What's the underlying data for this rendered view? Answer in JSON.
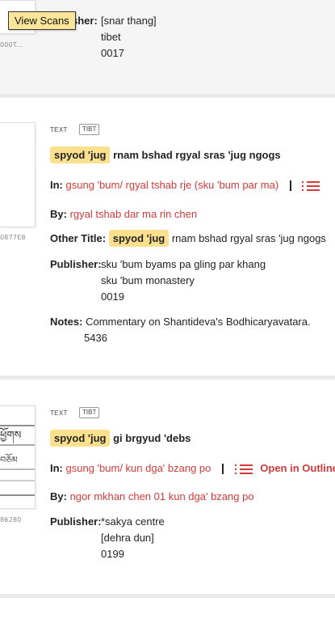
{
  "tooltip": "View Scans",
  "card0": {
    "thumb_id": "000T...",
    "publisher_label_partial": "sher:",
    "publisher_lines": [
      "[snar thang]",
      "tibet",
      "0017"
    ]
  },
  "card1": {
    "type": "TEXT",
    "script": "TIBT",
    "title_highlight": "spyod 'jug",
    "title_rest": "rnam bshad rgyal sras 'jug ngogs",
    "in_label": "In:",
    "in_link": "gsung 'bum/ rgyal tshab rje (sku 'bum par ma)",
    "by_label": "By:",
    "by_link": "rgyal tshab dar ma rin chen",
    "other_title_label": "Other Title:",
    "other_title_highlight": "spyod 'jug",
    "other_title_rest": "rnam bshad rgyal sras 'jug ngogs",
    "publisher_label": "Publisher:",
    "publisher_lines": [
      "sku 'bum byams pa gling par khang",
      "sku 'bum monastery",
      "0019"
    ],
    "notes_label": "Notes:",
    "notes_lines": [
      "Commentary on Shantideva's Bodhicaryavatara.",
      "5436"
    ],
    "thumb_id": "0877E8"
  },
  "card2": {
    "type": "TEXT",
    "script": "TIBT",
    "title_highlight": "spyod 'jug",
    "title_rest": "gi brgyud 'debs",
    "in_label": "In:",
    "in_link": "gsung 'bum/ kun dga' bzang po",
    "outline_label": "Open in Outline",
    "by_label": "By:",
    "by_link": "ngor mkhan chen 01 kun dga' bzang po",
    "publisher_label": "Publisher:",
    "publisher_lines": [
      "*sakya centre",
      "[dehra dun]",
      "0199"
    ],
    "thumb_id": "86280"
  },
  "colors": {
    "accent": "#d23a3a",
    "highlight": "#fbe08d",
    "tooltip": "#fbe59a"
  }
}
